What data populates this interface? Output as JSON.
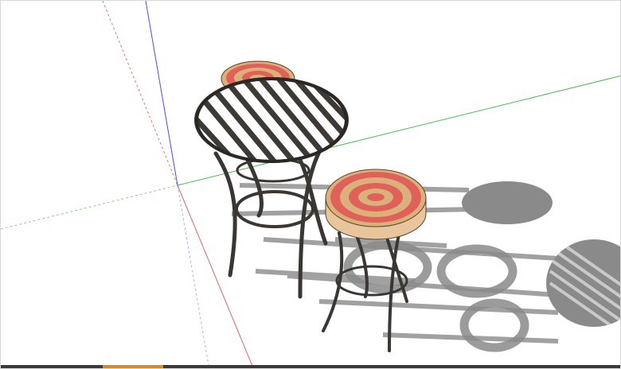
{
  "viewport": {
    "background": "#ffffff",
    "axis_colors": {
      "red": "#d04040",
      "green": "#3cb043",
      "blue": "#3a3ad0"
    }
  },
  "model": {
    "table_top_frame_color": "#3d3a36",
    "frame_color": "#3a3733",
    "cushion_colors": {
      "red": "#e0605a",
      "tan": "#dcb07a"
    },
    "shadow_color": "#8a8a8a"
  },
  "status_bar": {
    "accent_color": "#d08a30"
  }
}
